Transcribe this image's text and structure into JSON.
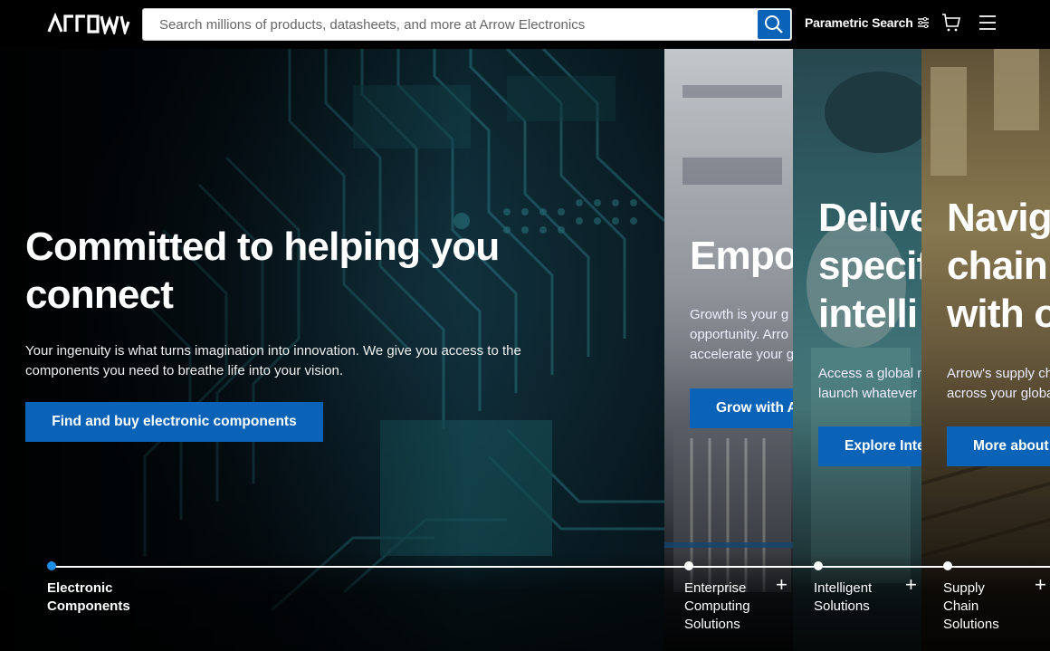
{
  "header": {
    "logo_text": "ARROW",
    "search_placeholder": "Search millions of products, datasheets, and more at Arrow Electronics",
    "parametric_label": "Parametric Search",
    "icons": [
      "search-icon",
      "filter-icon",
      "cart-icon",
      "menu-icon"
    ]
  },
  "hero": {
    "title": "Committed to helping you connect",
    "description": "Your ingenuity is what turns imagination into innovation. We give you access to the components you need to breathe life into your vision.",
    "cta": "Find and buy electronic components"
  },
  "panels": [
    {
      "title": "Empo",
      "desc_line1": "Growth is your g",
      "desc_line2": "opportunity. Arro",
      "desc_line3": "accelerate your g",
      "cta": "Grow with A"
    },
    {
      "title_line1": "Delive",
      "title_line2": "specif",
      "title_line3": "intelli",
      "desc_line1": "Access a global n",
      "desc_line2": "launch whatever",
      "cta": "Explore Inte"
    },
    {
      "title_line1": "Navig",
      "title_line2": "chain",
      "title_line3": "with o",
      "desc_line1": "Arrow's supply ch",
      "desc_line2": "across your globa",
      "cta": "More about"
    }
  ],
  "bottom_nav": [
    {
      "label_line1": "Electronic",
      "label_line2": "Components",
      "active": true
    },
    {
      "label_line1": "Enterprise",
      "label_line2": "Computing",
      "label_line3": "Solutions",
      "plus": "+"
    },
    {
      "label_line1": "Intelligent",
      "label_line2": "Solutions",
      "plus": "+"
    },
    {
      "label_line1": "Supply",
      "label_line2": "Chain",
      "label_line3": "Solutions",
      "plus": "+"
    }
  ],
  "colors": {
    "accent_blue": "#0b63b7",
    "active_dot": "#1e8fe8",
    "header_bg": "#000000"
  }
}
